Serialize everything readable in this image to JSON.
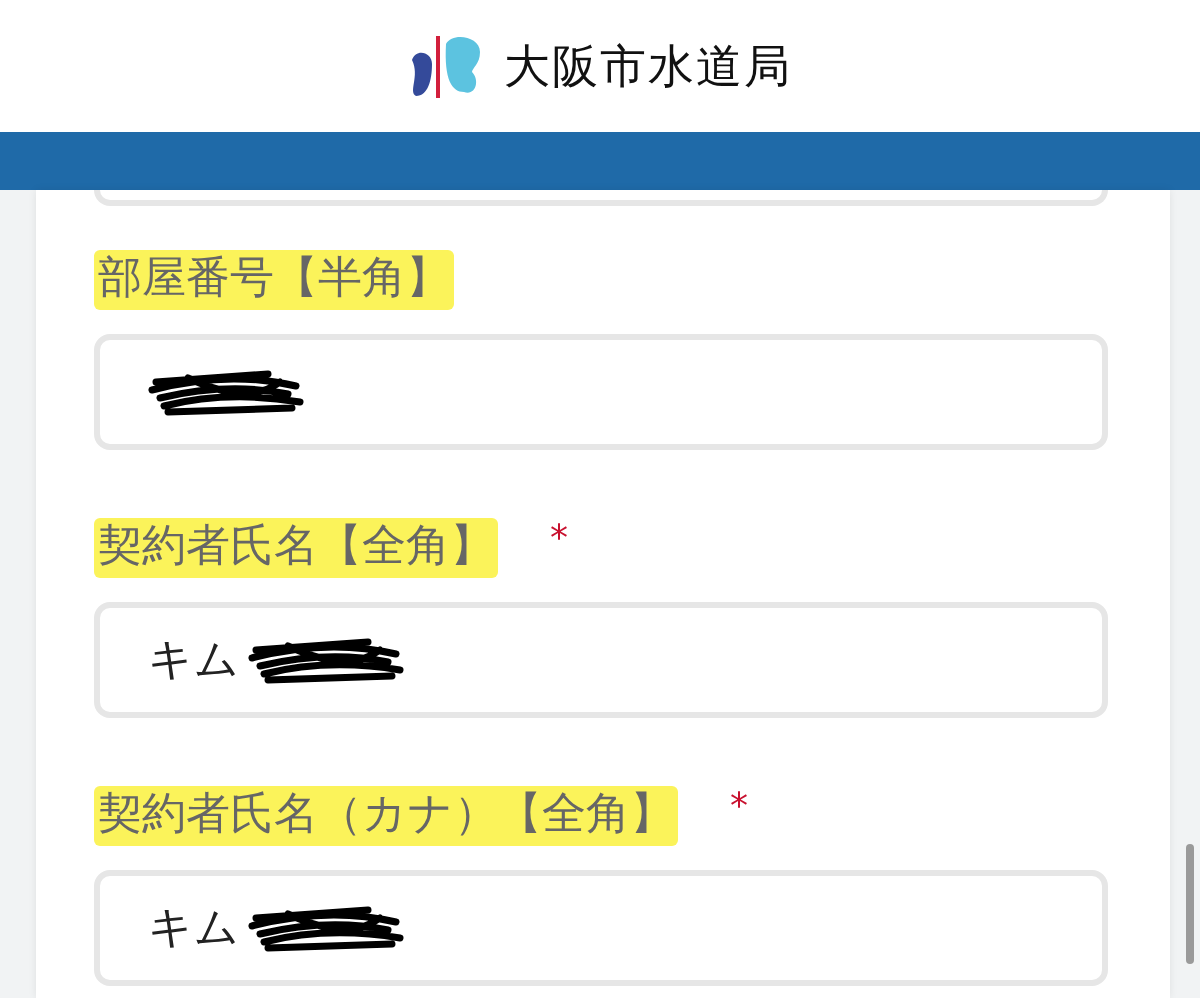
{
  "header": {
    "title": "大阪市水道局"
  },
  "fields": [
    {
      "label": "部屋番号【半角】",
      "highlighted": true,
      "required": false,
      "redacted": true
    },
    {
      "label": "契約者氏名【全角】",
      "highlighted": true,
      "required": true,
      "value": "キム",
      "redacted": true
    },
    {
      "label": "契約者氏名（カナ）【全角】",
      "highlighted": true,
      "required": true,
      "value": "キム",
      "redacted": true
    }
  ],
  "required_mark": "*"
}
